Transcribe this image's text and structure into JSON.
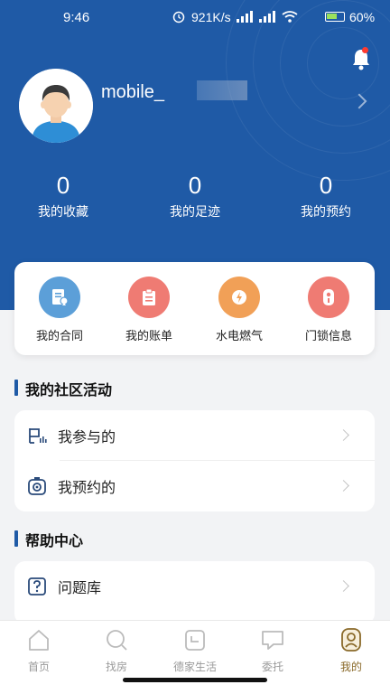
{
  "status_bar": {
    "time": "9:46",
    "network_speed": "921K/s",
    "battery": "60%"
  },
  "profile": {
    "username": "mobile_"
  },
  "stats": [
    {
      "value": "0",
      "label": "我的收藏"
    },
    {
      "value": "0",
      "label": "我的足迹"
    },
    {
      "value": "0",
      "label": "我的预约"
    }
  ],
  "quick_actions": [
    {
      "label": "我的合同",
      "icon": "contract-icon",
      "color": "#5c9fd8"
    },
    {
      "label": "我的账单",
      "icon": "bill-icon",
      "color": "#ef7b73"
    },
    {
      "label": "水电燃气",
      "icon": "utilities-icon",
      "color": "#f1a057"
    },
    {
      "label": "门锁信息",
      "icon": "door-lock-icon",
      "color": "#ef7b73"
    }
  ],
  "community": {
    "title": "我的社区活动",
    "items": [
      {
        "label": "我参与的",
        "icon": "participated-icon"
      },
      {
        "label": "我预约的",
        "icon": "reserved-icon"
      }
    ]
  },
  "help": {
    "title": "帮助中心",
    "items": [
      {
        "label": "问题库",
        "icon": "question-bank-icon"
      }
    ]
  },
  "tabbar": {
    "active": "我的",
    "active_color": "#8a6a2a",
    "items": [
      {
        "label": "首页",
        "icon": "home-icon"
      },
      {
        "label": "找房",
        "icon": "search-icon"
      },
      {
        "label": "德家生活",
        "icon": "life-icon"
      },
      {
        "label": "委托",
        "icon": "chat-icon"
      },
      {
        "label": "我的",
        "icon": "profile-icon"
      }
    ]
  },
  "colors": {
    "header": "#1f5aa6",
    "background": "#f2f3f5"
  }
}
